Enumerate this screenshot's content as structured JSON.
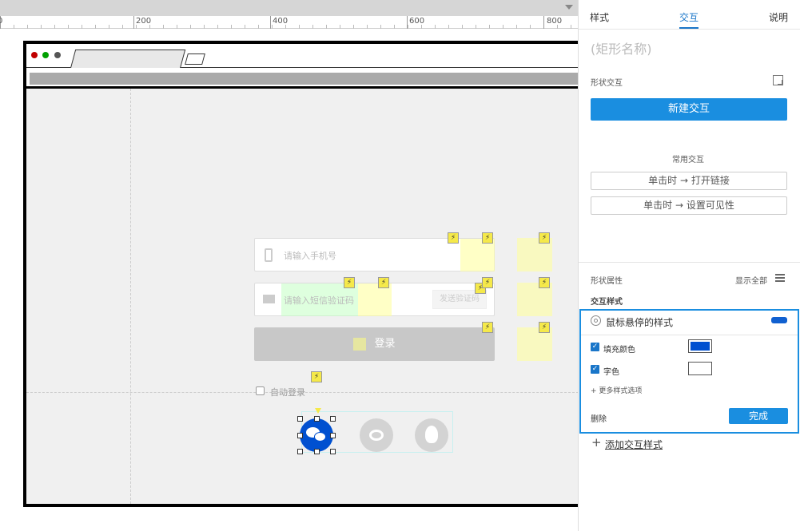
{
  "ruler": {
    "labels": [
      "0",
      "200",
      "400",
      "600",
      "800"
    ]
  },
  "browser_dots": [
    "#c00000",
    "#00a000",
    "#555555"
  ],
  "form": {
    "phone_placeholder": "请输入手机号",
    "sms_placeholder": "请输入短信验证码",
    "send_code_label": "发送验证码",
    "login_label": "登录",
    "auto_login_label": "自动登录"
  },
  "panel": {
    "tabs": [
      "样式",
      "交互",
      "说明"
    ],
    "active_tab": "交互",
    "shape_name": "(矩形名称)",
    "shape_interaction_label": "形状交互",
    "new_interaction_button": "新建交互",
    "common_interactions_label": "常用交互",
    "common_interactions": [
      "单击时 → 打开链接",
      "单击时 → 设置可见性"
    ],
    "shape_props_label": "形状属性",
    "show_all_label": "显示全部",
    "interaction_style_label": "交互样式",
    "hover_style": {
      "title": "鼠标悬停的样式",
      "fill_color_label": "填充颜色",
      "fill_color": "#0050d0",
      "text_color_label": "字色",
      "text_color": "#ffffff",
      "more_options": "+ 更多样式选项",
      "delete_label": "删除",
      "done_label": "完成"
    },
    "add_style_label": "添加交互样式"
  },
  "colors": {
    "accent": "#1a8ee0",
    "wechat_selected": "#0050d0",
    "icon_gray": "#d3d3d3"
  }
}
